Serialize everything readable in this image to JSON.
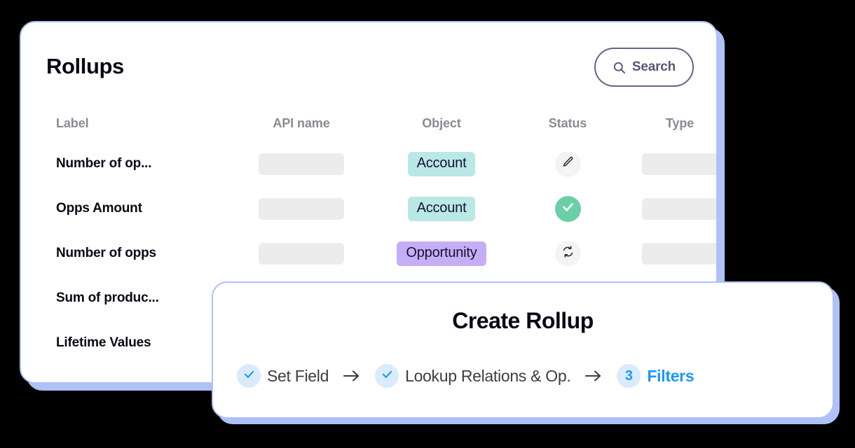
{
  "rollups_panel": {
    "title": "Rollups",
    "search": {
      "label": "Search",
      "icon": "search-icon"
    },
    "table": {
      "columns": [
        "Label",
        "API name",
        "Object",
        "Status",
        "Type"
      ],
      "rows": [
        {
          "label": "Number of op...",
          "api_name": "",
          "object": "Account",
          "object_color": "#b9e8e7",
          "status": "edit",
          "status_icon": "pencil-icon",
          "type": ""
        },
        {
          "label": "Opps Amount",
          "api_name": "",
          "object": "Account",
          "object_color": "#b9e8e7",
          "status": "success",
          "status_icon": "check-icon",
          "type": ""
        },
        {
          "label": "Number of opps",
          "api_name": "",
          "object": "Opportunity",
          "object_color": "#c5aef5",
          "status": "syncing",
          "status_icon": "sync-icon",
          "type": ""
        },
        {
          "label": "Sum of produc...",
          "api_name": "",
          "object": "",
          "status": "",
          "type": ""
        },
        {
          "label": "Lifetime Values",
          "api_name": "",
          "object": "",
          "status": "",
          "type": ""
        }
      ]
    }
  },
  "create_rollup_panel": {
    "title": "Create Rollup",
    "steps": [
      {
        "label": "Set Field",
        "state": "complete",
        "marker": "check"
      },
      {
        "label": "Lookup Relations & Op.",
        "state": "complete",
        "marker": "check"
      },
      {
        "label": "Filters",
        "state": "active",
        "marker": "3"
      }
    ],
    "arrow_glyph": "→"
  },
  "colors": {
    "card_border": "#aec2f7",
    "accent_blue": "#1b97fb",
    "success_green": "#69cfa5",
    "placeholder_gray": "#ececec",
    "search_outline": "#6b6183"
  }
}
